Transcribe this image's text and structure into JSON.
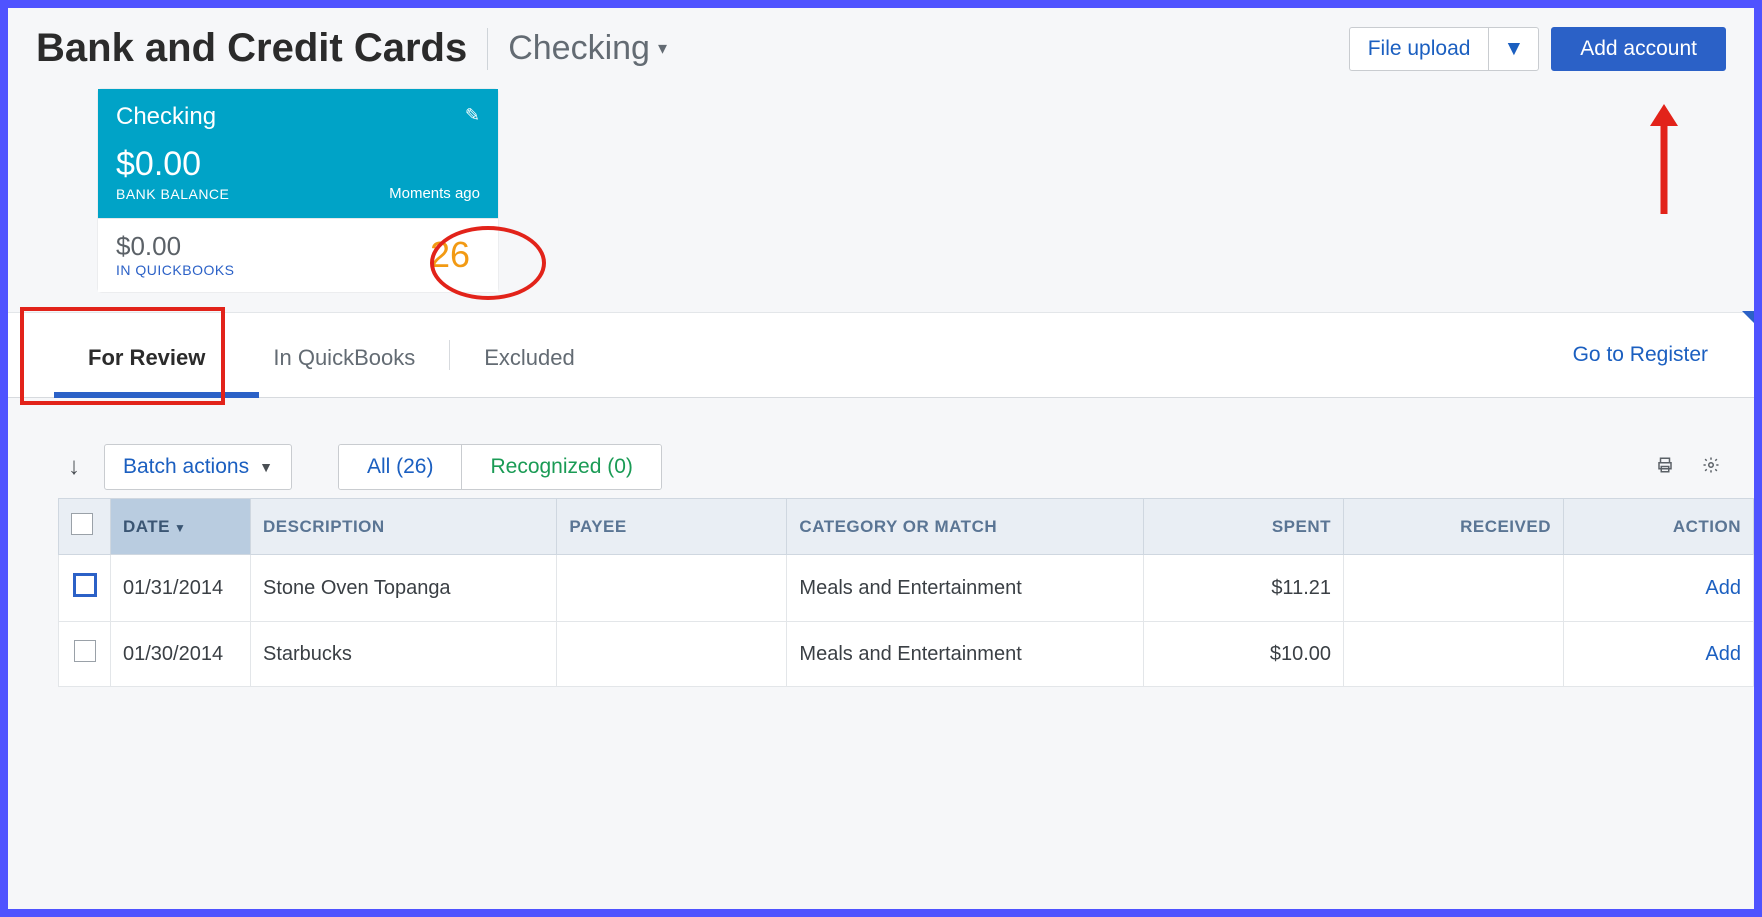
{
  "header": {
    "title": "Bank and Credit Cards",
    "account_selector": "Checking",
    "file_upload": "File upload",
    "add_account": "Add account"
  },
  "card": {
    "name": "Checking",
    "bank_balance": "$0.00",
    "bank_balance_label": "BANK BALANCE",
    "updated": "Moments ago",
    "qb_balance": "$0.00",
    "qb_balance_label": "IN QUICKBOOKS",
    "pending_count": "26"
  },
  "tabs": {
    "for_review": "For Review",
    "in_quickbooks": "In QuickBooks",
    "excluded": "Excluded",
    "go_to_register": "Go to Register"
  },
  "toolbar": {
    "batch_actions": "Batch actions",
    "all_label": "All (26)",
    "recognized_label": "Recognized (0)"
  },
  "table": {
    "headers": {
      "date": "DATE",
      "description": "DESCRIPTION",
      "payee": "PAYEE",
      "category": "CATEGORY OR MATCH",
      "spent": "SPENT",
      "received": "RECEIVED",
      "action": "ACTION"
    },
    "rows": [
      {
        "date": "01/31/2014",
        "description": "Stone Oven Topanga",
        "payee": "",
        "category": "Meals and Entertainment",
        "spent": "$11.21",
        "received": "",
        "action": "Add"
      },
      {
        "date": "01/30/2014",
        "description": "Starbucks",
        "payee": "",
        "category": "Meals and Entertainment",
        "spent": "$10.00",
        "received": "",
        "action": "Add"
      }
    ]
  }
}
